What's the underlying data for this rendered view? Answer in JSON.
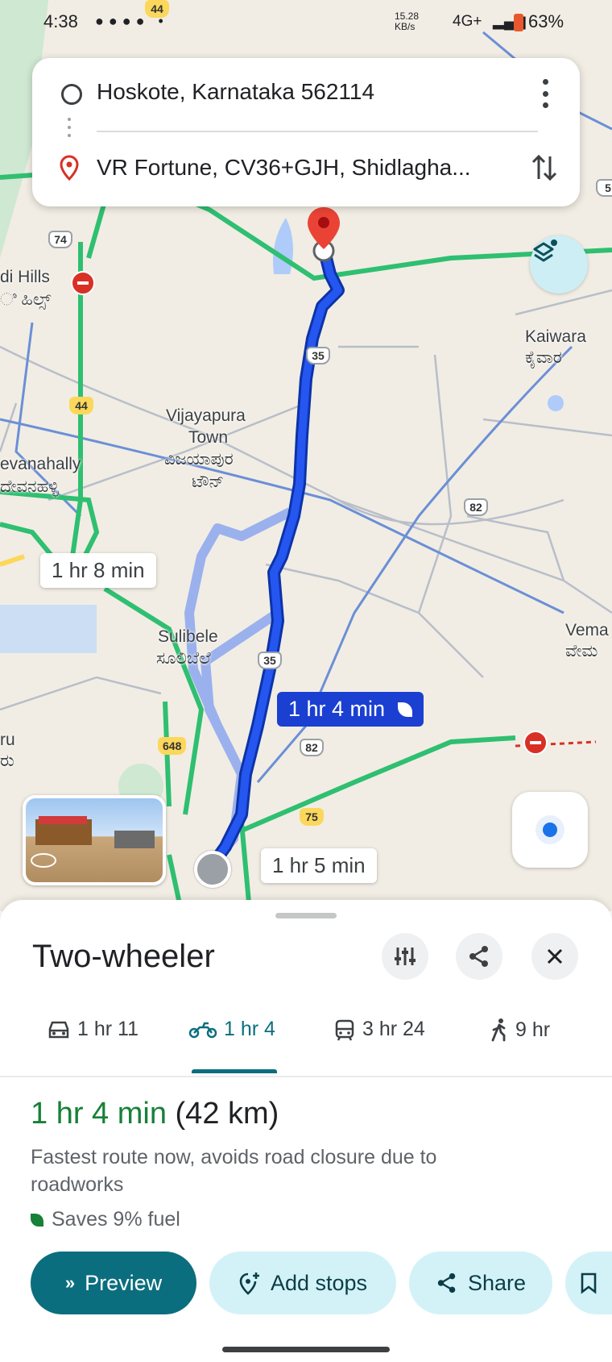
{
  "status_bar": {
    "time": "4:38",
    "network_speed": "15.28 KB/s",
    "signal": "4G+",
    "battery": "63%"
  },
  "route_card": {
    "origin": "Hoskote, Karnataka 562114",
    "destination": "VR Fortune, CV36+GJH, Shidlagha..."
  },
  "map": {
    "places": {
      "hills": "di Hills",
      "hills_kn": "ಿ ಹಿಲ್ಸ್",
      "kaiwara": "Kaiwara",
      "kaiwara_kn": "ಕೈವಾರ",
      "vijayapura_1": "Vijayapura",
      "vijayapura_2": "Town",
      "vijayapura_kn1": "ವಿಜಯಾಪುರ",
      "vijayapura_kn2": "ಟೌನ್",
      "devanahally": "evanahally",
      "devanahally_kn": "ದೇವನಹಳ್ಳಿ",
      "sulibele": "Sulibele",
      "sulibele_kn": "ಸೂಲಿಬೆಲೆ",
      "vema": "Vema",
      "vema_kn": "ವೇಮ",
      "ru": "ru",
      "ru_kn": "ರು"
    },
    "shields": {
      "s44_top": "44",
      "s74": "74",
      "s44": "44",
      "s35_top": "35",
      "s82_right": "82",
      "s35": "35",
      "s648": "648",
      "s82": "82",
      "s75": "75",
      "s5": "5"
    },
    "eta_alt1": "1 hr 8 min",
    "eta_main": "1 hr 4 min",
    "eta_alt2": "1 hr 5 min"
  },
  "sheet": {
    "title": "Two-wheeler",
    "modes": [
      {
        "label": "1 hr 11",
        "icon": "car-icon"
      },
      {
        "label": "1 hr 4",
        "icon": "motorbike-icon",
        "selected": true
      },
      {
        "label": "3 hr 24",
        "icon": "transit-icon"
      },
      {
        "label": "9 hr",
        "icon": "walk-icon"
      }
    ],
    "duration": "1 hr 4 min",
    "distance": "(42 km)",
    "description": "Fastest route now, avoids road closure due to roadworks",
    "fuel": "Saves 9% fuel",
    "buttons": {
      "preview": "Preview",
      "add_stops": "Add stops",
      "share": "Share"
    }
  },
  "colors": {
    "route_primary": "#1a3fd1",
    "route_alt": "#a8bdf0",
    "accent_green": "#188038",
    "preview_bg": "#0b6e7e",
    "pill_bg": "#d3f2f7"
  }
}
